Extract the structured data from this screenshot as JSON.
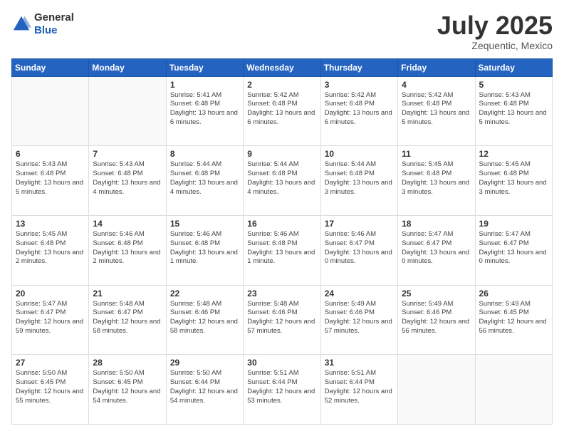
{
  "logo": {
    "general": "General",
    "blue": "Blue"
  },
  "header": {
    "month": "July 2025",
    "location": "Zequentic, Mexico"
  },
  "days_of_week": [
    "Sunday",
    "Monday",
    "Tuesday",
    "Wednesday",
    "Thursday",
    "Friday",
    "Saturday"
  ],
  "weeks": [
    [
      {
        "day": "",
        "info": ""
      },
      {
        "day": "",
        "info": ""
      },
      {
        "day": "1",
        "info": "Sunrise: 5:41 AM\nSunset: 6:48 PM\nDaylight: 13 hours and 6 minutes."
      },
      {
        "day": "2",
        "info": "Sunrise: 5:42 AM\nSunset: 6:48 PM\nDaylight: 13 hours and 6 minutes."
      },
      {
        "day": "3",
        "info": "Sunrise: 5:42 AM\nSunset: 6:48 PM\nDaylight: 13 hours and 6 minutes."
      },
      {
        "day": "4",
        "info": "Sunrise: 5:42 AM\nSunset: 6:48 PM\nDaylight: 13 hours and 5 minutes."
      },
      {
        "day": "5",
        "info": "Sunrise: 5:43 AM\nSunset: 6:48 PM\nDaylight: 13 hours and 5 minutes."
      }
    ],
    [
      {
        "day": "6",
        "info": "Sunrise: 5:43 AM\nSunset: 6:48 PM\nDaylight: 13 hours and 5 minutes."
      },
      {
        "day": "7",
        "info": "Sunrise: 5:43 AM\nSunset: 6:48 PM\nDaylight: 13 hours and 4 minutes."
      },
      {
        "day": "8",
        "info": "Sunrise: 5:44 AM\nSunset: 6:48 PM\nDaylight: 13 hours and 4 minutes."
      },
      {
        "day": "9",
        "info": "Sunrise: 5:44 AM\nSunset: 6:48 PM\nDaylight: 13 hours and 4 minutes."
      },
      {
        "day": "10",
        "info": "Sunrise: 5:44 AM\nSunset: 6:48 PM\nDaylight: 13 hours and 3 minutes."
      },
      {
        "day": "11",
        "info": "Sunrise: 5:45 AM\nSunset: 6:48 PM\nDaylight: 13 hours and 3 minutes."
      },
      {
        "day": "12",
        "info": "Sunrise: 5:45 AM\nSunset: 6:48 PM\nDaylight: 13 hours and 3 minutes."
      }
    ],
    [
      {
        "day": "13",
        "info": "Sunrise: 5:45 AM\nSunset: 6:48 PM\nDaylight: 13 hours and 2 minutes."
      },
      {
        "day": "14",
        "info": "Sunrise: 5:46 AM\nSunset: 6:48 PM\nDaylight: 13 hours and 2 minutes."
      },
      {
        "day": "15",
        "info": "Sunrise: 5:46 AM\nSunset: 6:48 PM\nDaylight: 13 hours and 1 minute."
      },
      {
        "day": "16",
        "info": "Sunrise: 5:46 AM\nSunset: 6:48 PM\nDaylight: 13 hours and 1 minute."
      },
      {
        "day": "17",
        "info": "Sunrise: 5:46 AM\nSunset: 6:47 PM\nDaylight: 13 hours and 0 minutes."
      },
      {
        "day": "18",
        "info": "Sunrise: 5:47 AM\nSunset: 6:47 PM\nDaylight: 13 hours and 0 minutes."
      },
      {
        "day": "19",
        "info": "Sunrise: 5:47 AM\nSunset: 6:47 PM\nDaylight: 13 hours and 0 minutes."
      }
    ],
    [
      {
        "day": "20",
        "info": "Sunrise: 5:47 AM\nSunset: 6:47 PM\nDaylight: 12 hours and 59 minutes."
      },
      {
        "day": "21",
        "info": "Sunrise: 5:48 AM\nSunset: 6:47 PM\nDaylight: 12 hours and 58 minutes."
      },
      {
        "day": "22",
        "info": "Sunrise: 5:48 AM\nSunset: 6:46 PM\nDaylight: 12 hours and 58 minutes."
      },
      {
        "day": "23",
        "info": "Sunrise: 5:48 AM\nSunset: 6:46 PM\nDaylight: 12 hours and 57 minutes."
      },
      {
        "day": "24",
        "info": "Sunrise: 5:49 AM\nSunset: 6:46 PM\nDaylight: 12 hours and 57 minutes."
      },
      {
        "day": "25",
        "info": "Sunrise: 5:49 AM\nSunset: 6:46 PM\nDaylight: 12 hours and 56 minutes."
      },
      {
        "day": "26",
        "info": "Sunrise: 5:49 AM\nSunset: 6:45 PM\nDaylight: 12 hours and 56 minutes."
      }
    ],
    [
      {
        "day": "27",
        "info": "Sunrise: 5:50 AM\nSunset: 6:45 PM\nDaylight: 12 hours and 55 minutes."
      },
      {
        "day": "28",
        "info": "Sunrise: 5:50 AM\nSunset: 6:45 PM\nDaylight: 12 hours and 54 minutes."
      },
      {
        "day": "29",
        "info": "Sunrise: 5:50 AM\nSunset: 6:44 PM\nDaylight: 12 hours and 54 minutes."
      },
      {
        "day": "30",
        "info": "Sunrise: 5:51 AM\nSunset: 6:44 PM\nDaylight: 12 hours and 53 minutes."
      },
      {
        "day": "31",
        "info": "Sunrise: 5:51 AM\nSunset: 6:44 PM\nDaylight: 12 hours and 52 minutes."
      },
      {
        "day": "",
        "info": ""
      },
      {
        "day": "",
        "info": ""
      }
    ]
  ]
}
